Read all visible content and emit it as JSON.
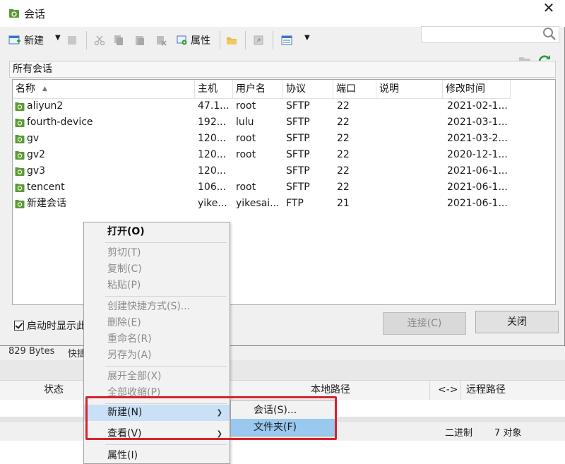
{
  "window": {
    "title": "会话"
  },
  "toolbar": {
    "new_label": "新建",
    "properties_label": "属性"
  },
  "path": {
    "label": "所有会话"
  },
  "columns": [
    "名称",
    "主机",
    "用户名",
    "协议",
    "端口",
    "说明",
    "修改时间"
  ],
  "sessions": [
    {
      "name": "aliyun2",
      "host": "47.1...",
      "user": "root",
      "protocol": "SFTP",
      "port": "22",
      "desc": "",
      "modified": "2021-02-1..."
    },
    {
      "name": "fourth-device",
      "host": "192...",
      "user": "lulu",
      "protocol": "SFTP",
      "port": "22",
      "desc": "",
      "modified": "2021-03-1..."
    },
    {
      "name": "gv",
      "host": "120...",
      "user": "root",
      "protocol": "SFTP",
      "port": "22",
      "desc": "",
      "modified": "2021-03-2..."
    },
    {
      "name": "gv2",
      "host": "120...",
      "user": "root",
      "protocol": "SFTP",
      "port": "22",
      "desc": "",
      "modified": "2020-12-1..."
    },
    {
      "name": "gv3",
      "host": "120...",
      "user": "",
      "protocol": "SFTP",
      "port": "22",
      "desc": "",
      "modified": "2021-06-1..."
    },
    {
      "name": "tencent",
      "host": "106...",
      "user": "root",
      "protocol": "SFTP",
      "port": "22",
      "desc": "",
      "modified": "2021-06-1..."
    },
    {
      "name": "新建会话",
      "host": "yike...",
      "user": "yikesai...",
      "protocol": "FTP",
      "port": "21",
      "desc": "",
      "modified": "2021-06-1..."
    }
  ],
  "footer": {
    "startup_checkbox_label": "启动时显示此",
    "connect_label": "连接(C)",
    "close_label": "关闭"
  },
  "background": {
    "status_text": "829 Bytes",
    "status_text2": "快捷",
    "col_status": "状态",
    "col_local_path": "本地路径",
    "col_arrow": "<->",
    "col_remote_path": "远程路径",
    "mode": "二进制",
    "objects": "7 对象"
  },
  "context_menu": {
    "open": "打开(O)",
    "cut": "剪切(T)",
    "copy": "复制(C)",
    "paste": "粘贴(P)",
    "create_shortcut": "创建快捷方式(S)...",
    "delete": "删除(E)",
    "rename": "重命名(R)",
    "save_as": "另存为(A)",
    "expand_all": "展开全部(X)",
    "collapse_all": "全部收缩(P)",
    "new": "新建(N)",
    "view": "查看(V)",
    "properties": "属性(I)"
  },
  "submenu": {
    "session": "会话(S)...",
    "folder": "文件夹(F)"
  },
  "colors": {
    "highlight": "#99c9ef",
    "annotation_red": "#d6232c",
    "session_icon_green": "#4a8a2a"
  }
}
